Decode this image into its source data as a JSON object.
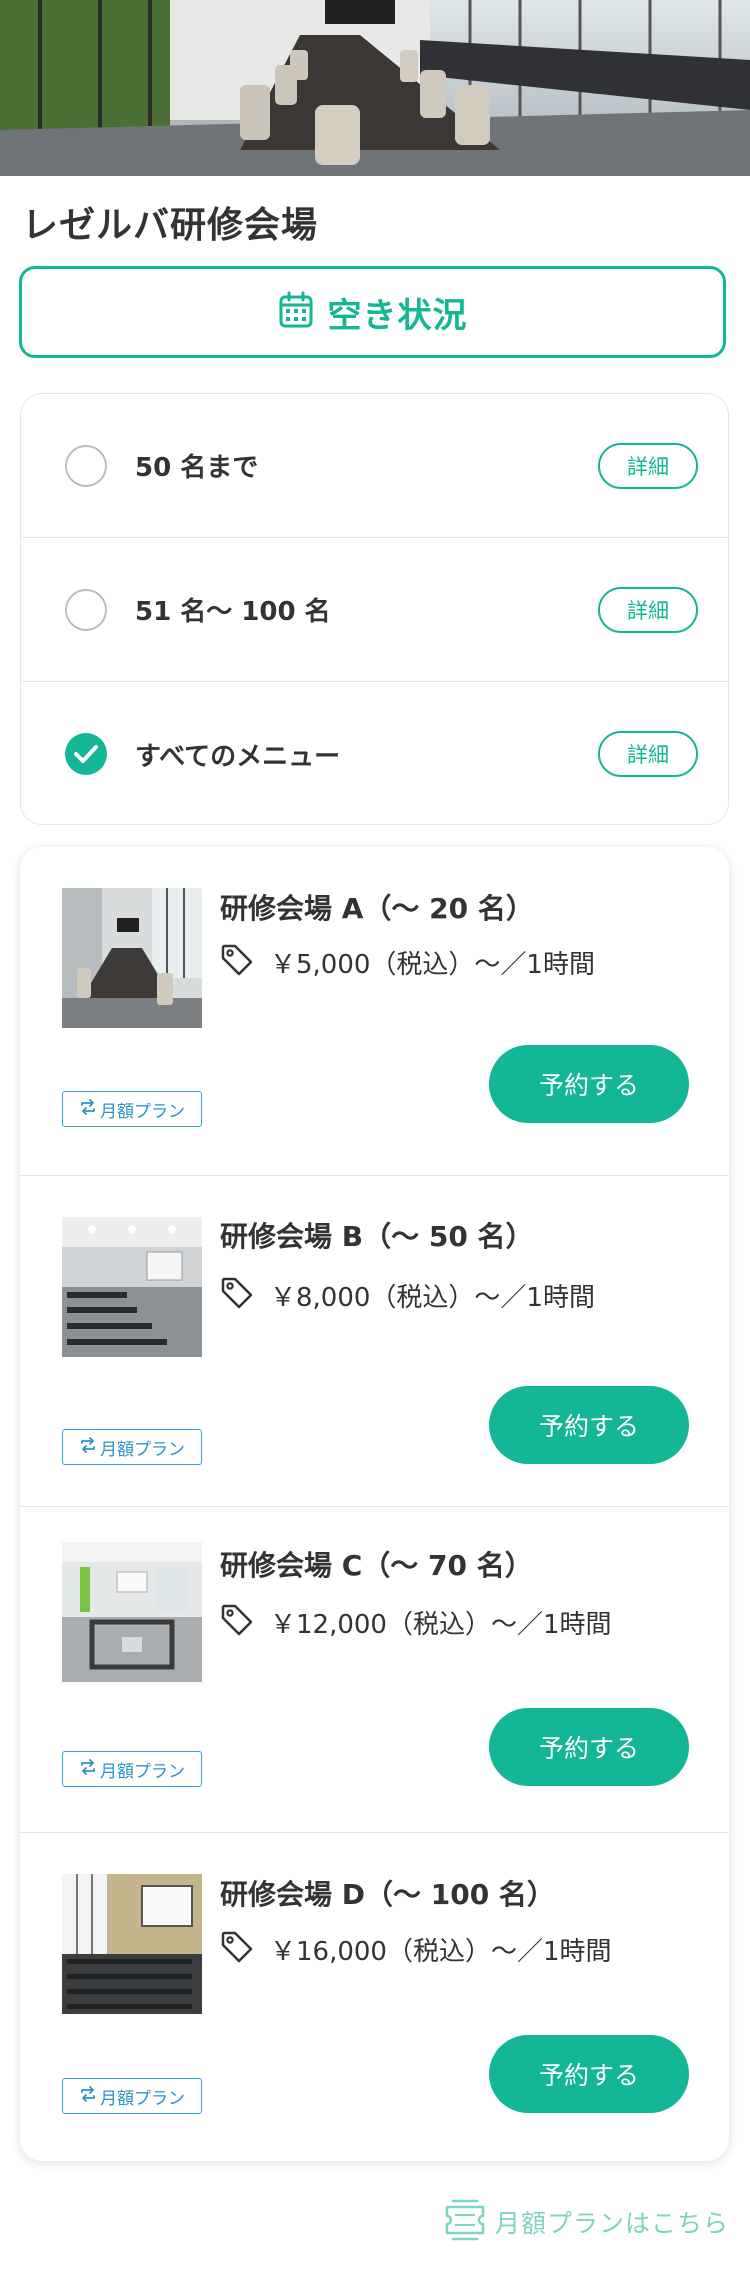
{
  "venue": {
    "name": "レゼルバ研修会場"
  },
  "availability": {
    "label": "空き状況",
    "icon": "calendar-icon"
  },
  "menu_options": [
    {
      "label": "50 名まで",
      "detail_label": "詳細",
      "checked": false
    },
    {
      "label": "51 名〜 100 名",
      "detail_label": "詳細",
      "checked": false
    },
    {
      "label": "すべてのメニュー",
      "detail_label": "詳細",
      "checked": true
    }
  ],
  "rooms": [
    {
      "name": "研修会場 A（〜 20 名）",
      "price": "￥5,000（税込）〜／1時間",
      "reserve_label": "予約する",
      "monthly_label": "月額プラン"
    },
    {
      "name": "研修会場 B（〜 50 名）",
      "price": "￥8,000（税込）〜／1時間",
      "reserve_label": "予約する",
      "monthly_label": "月額プラン"
    },
    {
      "name": "研修会場 C（〜 70 名）",
      "price": "￥12,000（税込）〜／1時間",
      "reserve_label": "予約する",
      "monthly_label": "月額プラン"
    },
    {
      "name": "研修会場 D（〜 100 名）",
      "price": "￥16,000（税込）〜／1時間",
      "reserve_label": "予約する",
      "monthly_label": "月額プラン"
    }
  ],
  "footer": {
    "monthly_link": "月額プランはこちら",
    "icon": "ticket-icon"
  },
  "colors": {
    "accent": "#13b695",
    "badge": "#2a93c9",
    "link": "#7dd4c2"
  }
}
